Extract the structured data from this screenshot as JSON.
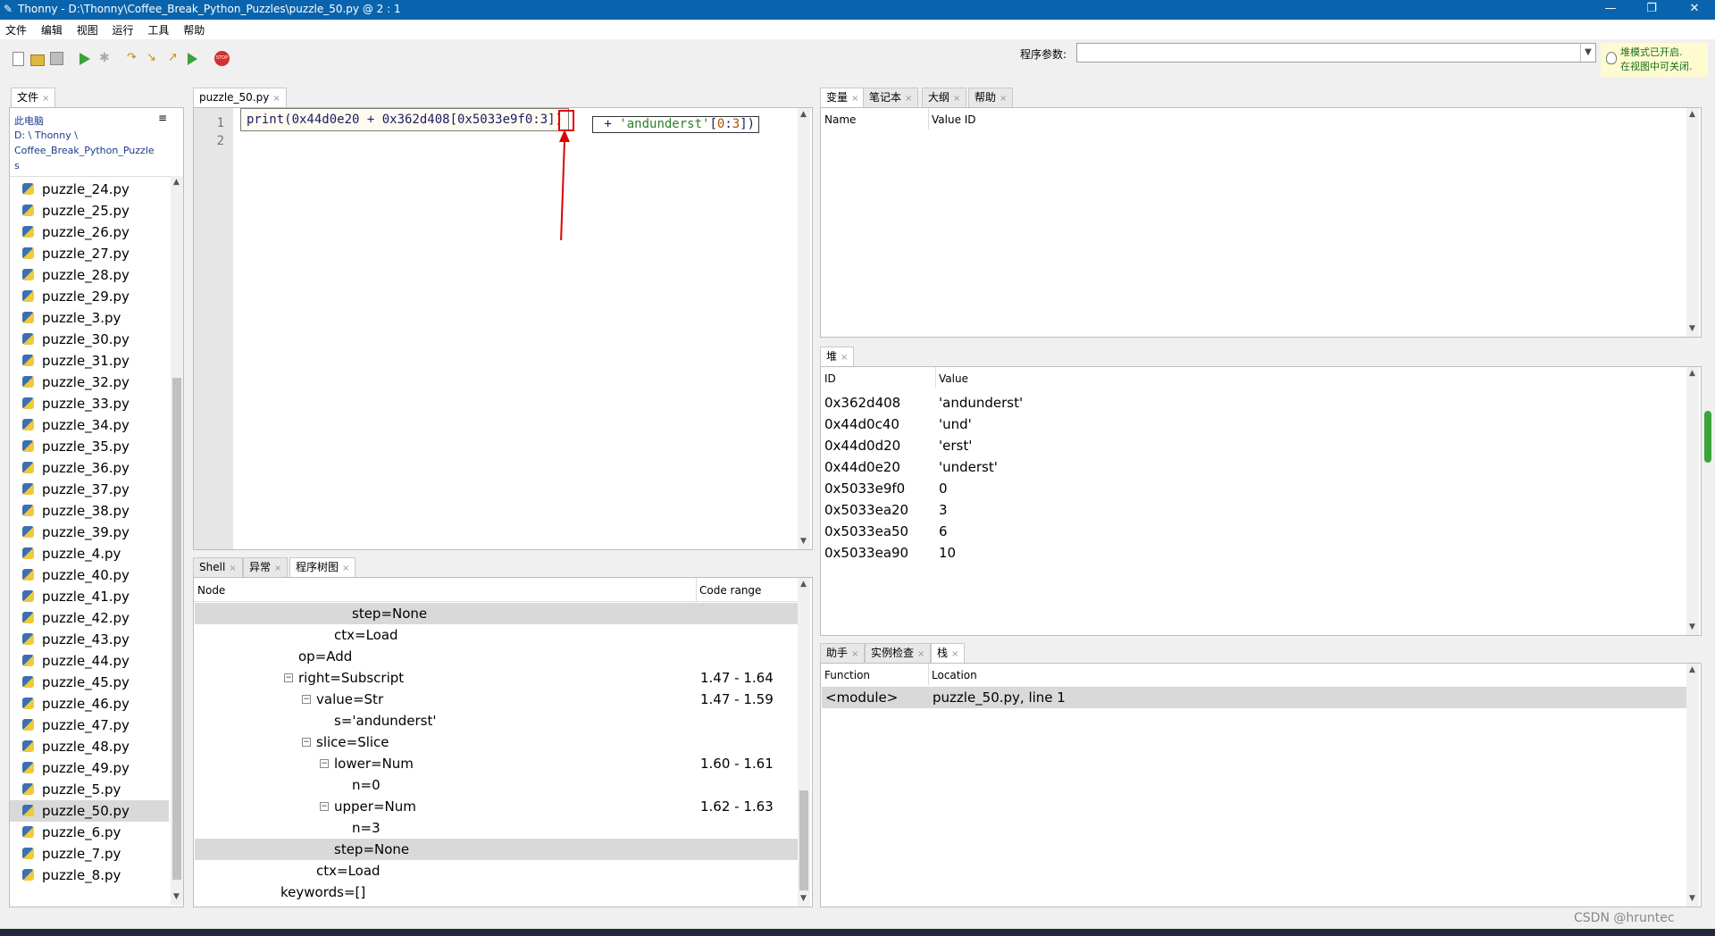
{
  "window": {
    "app_name": "Thonny",
    "title": "Thonny  -  D:\\Thonny\\Coffee_Break_Python_Puzzles\\puzzle_50.py  @  2 : 1",
    "minimize": "—",
    "maximize": "❐",
    "close": "✕"
  },
  "menu": [
    "文件",
    "编辑",
    "视图",
    "运行",
    "工具",
    "帮助"
  ],
  "toolbar": {
    "param_label": "程序参数:",
    "param_value": "",
    "heap_note_line1": "堆模式已开启.",
    "heap_note_line2": "在视图中可关闭."
  },
  "files": {
    "tab_label": "文件",
    "computer_label": "此电脑",
    "path_lines": [
      "D: \\ Thonny \\",
      "Coffee_Break_Python_Puzzle",
      "s"
    ],
    "items": [
      "puzzle_24.py",
      "puzzle_25.py",
      "puzzle_26.py",
      "puzzle_27.py",
      "puzzle_28.py",
      "puzzle_29.py",
      "puzzle_3.py",
      "puzzle_30.py",
      "puzzle_31.py",
      "puzzle_32.py",
      "puzzle_33.py",
      "puzzle_34.py",
      "puzzle_35.py",
      "puzzle_36.py",
      "puzzle_37.py",
      "puzzle_38.py",
      "puzzle_39.py",
      "puzzle_4.py",
      "puzzle_40.py",
      "puzzle_41.py",
      "puzzle_42.py",
      "puzzle_43.py",
      "puzzle_44.py",
      "puzzle_45.py",
      "puzzle_46.py",
      "puzzle_47.py",
      "puzzle_48.py",
      "puzzle_49.py",
      "puzzle_5.py",
      "puzzle_50.py",
      "puzzle_6.py",
      "puzzle_7.py",
      "puzzle_8.py"
    ],
    "selected": "puzzle_50.py"
  },
  "editor": {
    "tab_label": "puzzle_50.py",
    "line_numbers": [
      "1",
      "2"
    ],
    "tooltip_code": "print(0x44d0e20 + 0x362d408[0x5033e9f0:3])",
    "code_tail_plain": " + ",
    "code_tail_str": "'andunderst'",
    "code_tail_open": "[",
    "code_tail_num1": "0",
    "code_tail_colon": ":",
    "code_tail_num2": "3",
    "code_tail_close": "])"
  },
  "bottom_tabs": [
    "Shell",
    "异常",
    "程序树图"
  ],
  "tree": {
    "col_node": "Node",
    "col_range": "Code range",
    "rows": [
      {
        "label": "step=None",
        "range": "",
        "indent": 4,
        "selected": true,
        "collapse": false
      },
      {
        "label": "ctx=Load",
        "range": "",
        "indent": 3,
        "selected": false,
        "collapse": false
      },
      {
        "label": "op=Add",
        "range": "",
        "indent": 1,
        "selected": false,
        "collapse": false
      },
      {
        "label": "right=Subscript",
        "range": "1.47  -  1.64",
        "indent": 1,
        "selected": false,
        "collapse": true
      },
      {
        "label": "value=Str",
        "range": "1.47  -  1.59",
        "indent": 2,
        "selected": false,
        "collapse": true
      },
      {
        "label": "s='andunderst'",
        "range": "",
        "indent": 3,
        "selected": false,
        "collapse": false
      },
      {
        "label": "slice=Slice",
        "range": "",
        "indent": 2,
        "selected": false,
        "collapse": true
      },
      {
        "label": "lower=Num",
        "range": "1.60  -  1.61",
        "indent": 3,
        "selected": false,
        "collapse": true
      },
      {
        "label": "n=0",
        "range": "",
        "indent": 4,
        "selected": false,
        "collapse": false
      },
      {
        "label": "upper=Num",
        "range": "1.62  -  1.63",
        "indent": 3,
        "selected": false,
        "collapse": true
      },
      {
        "label": "n=3",
        "range": "",
        "indent": 4,
        "selected": false,
        "collapse": false
      },
      {
        "label": "step=None",
        "range": "",
        "indent": 3,
        "selected": true,
        "collapse": false
      },
      {
        "label": "ctx=Load",
        "range": "",
        "indent": 2,
        "selected": false,
        "collapse": false
      },
      {
        "label": "keywords=[]",
        "range": "",
        "indent": 0,
        "selected": false,
        "collapse": false
      }
    ]
  },
  "vars_tabs": [
    "变量",
    "笔记本",
    "大纲",
    "帮助"
  ],
  "vars": {
    "col_name": "Name",
    "col_value_id": "Value ID"
  },
  "heap_tab": "堆",
  "heap": {
    "col_id": "ID",
    "col_value": "Value",
    "rows": [
      {
        "id": "0x362d408",
        "value": "'andunderst'"
      },
      {
        "id": "0x44d0c40",
        "value": "'und'"
      },
      {
        "id": "0x44d0d20",
        "value": "'erst'"
      },
      {
        "id": "0x44d0e20",
        "value": "'underst'"
      },
      {
        "id": "0x5033e9f0",
        "value": "0"
      },
      {
        "id": "0x5033ea20",
        "value": "3"
      },
      {
        "id": "0x5033ea50",
        "value": "6"
      },
      {
        "id": "0x5033ea90",
        "value": "10"
      }
    ]
  },
  "stack_tabs": [
    "助手",
    "实例检查",
    "栈"
  ],
  "stack": {
    "col_function": "Function",
    "col_location": "Location",
    "row_function": "<module>",
    "row_location": "puzzle_50.py, line 1"
  },
  "watermark": "CSDN @hruntec"
}
